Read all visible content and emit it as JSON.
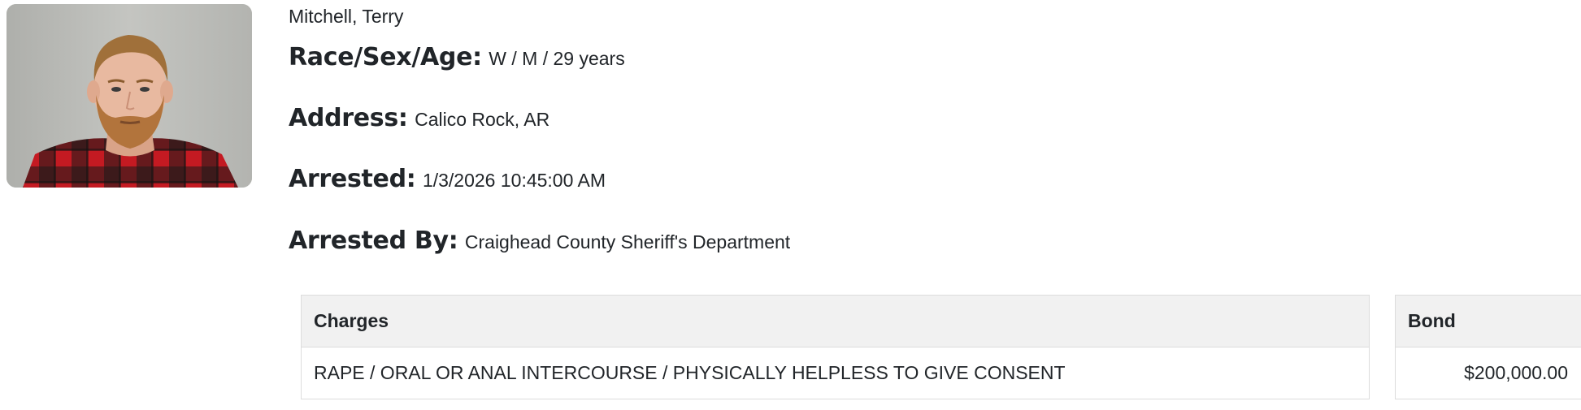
{
  "person": {
    "name": "Mitchell, Terry",
    "fields": [
      {
        "label": "Race/Sex/Age:",
        "value": "W / M / 29 years"
      },
      {
        "label": "Address:",
        "value": "Calico Rock, AR"
      },
      {
        "label": "Arrested:",
        "value": "1/3/2026 10:45:00 AM"
      },
      {
        "label": "Arrested By:",
        "value": "Craighead County Sheriff's Department"
      }
    ]
  },
  "charges_table": {
    "header": "Charges",
    "rows": [
      "RAPE / ORAL OR ANAL INTERCOURSE / PHYSICALLY HELPLESS TO GIVE CONSENT"
    ]
  },
  "bond_table": {
    "header": "Bond",
    "rows": [
      "$200,000.00"
    ]
  },
  "photo": {
    "icon": "mugshot-photo",
    "colors": {
      "background": "#b9bab6",
      "shirt_red": "#c41a22",
      "shirt_black": "#1a1a1a",
      "hair": "#a0703a",
      "skin": "#e8b9a0"
    }
  }
}
